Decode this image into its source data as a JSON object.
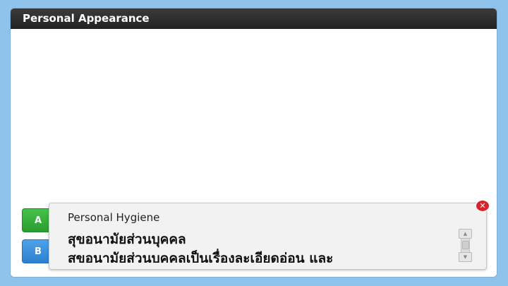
{
  "window": {
    "title": "Personal Appearance"
  },
  "side_buttons": {
    "a_label": "A",
    "b_label": "B"
  },
  "popup": {
    "title": "Personal Hygiene",
    "heading": "สุขอนามัยส่วนบุคคล",
    "text": "สุขอนามัยส่วนบุคคลเป็นเรื่องละเอียดอ่อน และ"
  },
  "icons": {
    "close": "close-icon",
    "scroll_up": "chevron-up-icon",
    "scroll_down": "chevron-down-icon"
  },
  "colors": {
    "background": "#8fc3ec",
    "titlebar": "#2e2e2e",
    "button_a": "#2fa636",
    "button_b": "#3a8bdc",
    "close": "#d9232a"
  }
}
